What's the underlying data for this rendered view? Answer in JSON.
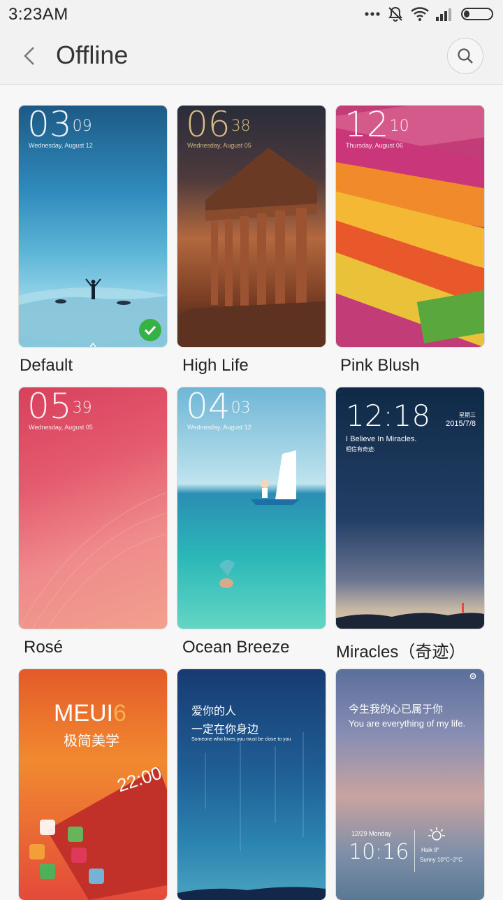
{
  "status_bar": {
    "time": "3:23AM",
    "icons": [
      "more-dots-icon",
      "mute-bell-icon",
      "wifi-icon",
      "signal-icon",
      "battery-icon"
    ]
  },
  "header": {
    "title": "Offline",
    "back_icon": "chevron-left-icon",
    "search_icon": "search-icon"
  },
  "themes": [
    {
      "name": "Default",
      "clock_hour": "03",
      "clock_min": "09",
      "date": "Wednesday, August 12",
      "selected": true
    },
    {
      "name": "High Life",
      "clock_hour": "06",
      "clock_min": "38",
      "date": "Wednesday, August 05"
    },
    {
      "name": "Pink Blush",
      "clock_hour": "12",
      "clock_min": "10",
      "date": "Thursday, August 06"
    },
    {
      "name": "Rosé",
      "clock_hour": "05",
      "clock_min": "39",
      "date": "Wednesday, August 05"
    },
    {
      "name": "Ocean Breeze",
      "clock_hour": "04",
      "clock_min": "03",
      "date": "Wednesday, August 12"
    },
    {
      "name": "Miracles（奇迹）",
      "clock": "12:18",
      "weekday": "星期三",
      "date": "2015/7/8",
      "quote": "I Believe In Miracles.",
      "quote_cn": "相信有奇迹."
    },
    {
      "brand": "MEUI",
      "brand_num": "6",
      "tagline": "极简美学",
      "clock": "22:00"
    },
    {
      "line1": "爱你的人",
      "line2": "一定在你身边",
      "sub": "Someone who loves you must be close to you"
    },
    {
      "line1": "今生我的心已属于你",
      "sub": "You are everything of my life.",
      "date": "12/29  Monday",
      "clock": "10:16",
      "city": "Haik   8°",
      "weather": "Sunny 10°C~2°C"
    }
  ]
}
